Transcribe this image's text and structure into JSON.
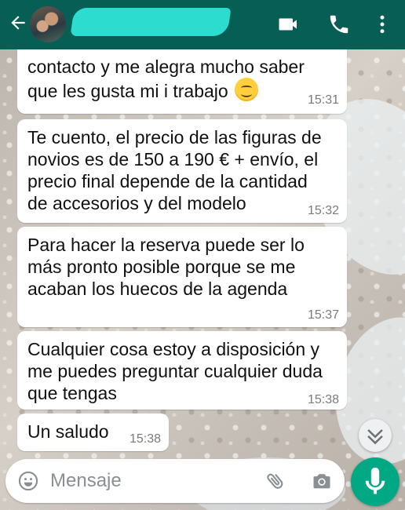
{
  "header": {
    "contact_name": "",
    "icons": [
      "back-arrow-icon",
      "avatar",
      "video-call-icon",
      "phone-icon",
      "more-options-icon"
    ],
    "color": "#075e54"
  },
  "messages": [
    {
      "lines": [
        "contacto y me alegra mucho saber",
        "que les gusta mi i trabajo"
      ],
      "emoji": "smiling-face-icon",
      "time": "15:31"
    },
    {
      "lines": [
        "Te cuento, el precio de las figuras de",
        "novios es de 150 a 190 € + envío, el",
        "precio final depende de la cantidad",
        "de accesorios y del modelo"
      ],
      "time": "15:32"
    },
    {
      "lines": [
        "Para hacer la reserva puede ser lo",
        "más pronto posible porque se me",
        "acaban los huecos de la agenda"
      ],
      "time": "15:37"
    },
    {
      "lines": [
        "Cualquier cosa estoy a disposición y",
        "me puedes preguntar cualquier duda",
        "que tengas"
      ],
      "time": "15:38"
    },
    {
      "lines": [
        "Un saludo"
      ],
      "time": "15:38"
    }
  ],
  "composer": {
    "placeholder": "Mensaje",
    "icons": [
      "emoji-icon",
      "attach-icon",
      "camera-icon",
      "mic-icon"
    ],
    "accent": "#00a884"
  }
}
